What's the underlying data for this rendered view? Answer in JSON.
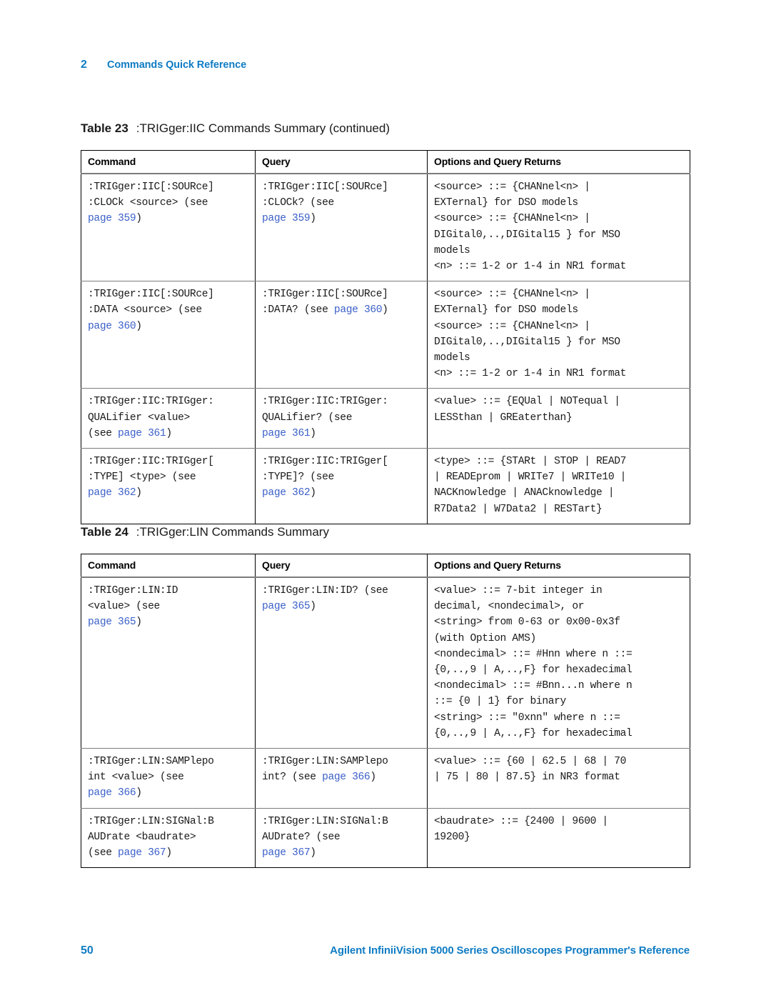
{
  "running_header": {
    "chapter_number": "2",
    "chapter_title": "Commands Quick Reference"
  },
  "colors": {
    "brand_blue": "#0f7cc4",
    "link_blue": "#3a5fc8",
    "rule_gray": "#7c7c7c",
    "border_black": "#000000"
  },
  "tables": [
    {
      "caption_label": "Table 23",
      "caption_text": ":TRIGger:IIC Commands Summary (continued)",
      "headers": [
        "Command",
        "Query",
        "Options and Query Returns"
      ],
      "rows": [
        {
          "command": ":TRIGger:IIC[:SOURce]\n:CLOCk <source> (see\npage 359)",
          "query": ":TRIGger:IIC[:SOURce]\n:CLOCk? (see\npage 359)",
          "options": "<source> ::= {CHANnel<n> |\nEXTernal} for DSO models\n<source> ::= {CHANnel<n> |\nDIGital0,..,DIGital15 } for MSO\nmodels\n<n> ::= 1-2 or 1-4 in NR1 format"
        },
        {
          "command": ":TRIGger:IIC[:SOURce]\n:DATA <source> (see\npage 360)",
          "query": ":TRIGger:IIC[:SOURce]\n:DATA? (see page 360)",
          "options": "<source> ::= {CHANnel<n> |\nEXTernal} for DSO models\n<source> ::= {CHANnel<n> |\nDIGital0,..,DIGital15 } for MSO\nmodels\n<n> ::= 1-2 or 1-4 in NR1 format"
        },
        {
          "command": ":TRIGger:IIC:TRIGger:\nQUALifier <value>\n(see page 361)",
          "query": ":TRIGger:IIC:TRIGger:\nQUALifier? (see\npage 361)",
          "options": "<value> ::= {EQUal | NOTequal |\nLESSthan | GREaterthan}"
        },
        {
          "command": ":TRIGger:IIC:TRIGger[\n:TYPE] <type> (see\npage 362)",
          "query": ":TRIGger:IIC:TRIGger[\n:TYPE]? (see\npage 362)",
          "options": "<type> ::= {STARt | STOP | READ7\n| READEprom | WRITe7 | WRITe10 |\nNACKnowledge | ANACknowledge |\nR7Data2 | W7Data2 | RESTart}"
        }
      ]
    },
    {
      "caption_label": "Table 24",
      "caption_text": ":TRIGger:LIN Commands Summary",
      "headers": [
        "Command",
        "Query",
        "Options and Query Returns"
      ],
      "rows": [
        {
          "command": ":TRIGger:LIN:ID\n<value> (see\npage 365)",
          "query": ":TRIGger:LIN:ID? (see\npage 365)",
          "options": "<value> ::= 7-bit integer in\ndecimal, <nondecimal>, or\n<string> from 0-63 or 0x00-0x3f\n(with Option AMS)\n<nondecimal> ::= #Hnn where n ::=\n{0,..,9 | A,..,F} for hexadecimal\n<nondecimal> ::= #Bnn...n where n\n::= {0 | 1} for binary\n<string> ::= \"0xnn\" where n ::=\n{0,..,9 | A,..,F} for hexadecimal"
        },
        {
          "command": ":TRIGger:LIN:SAMPlepo\nint <value> (see\npage 366)",
          "query": ":TRIGger:LIN:SAMPlepo\nint? (see page 366)",
          "options": "<value> ::= {60 | 62.5 | 68 | 70\n| 75 | 80 | 87.5} in NR3 format"
        },
        {
          "command": ":TRIGger:LIN:SIGNal:B\nAUDrate <baudrate>\n(see page 367)",
          "query": ":TRIGger:LIN:SIGNal:B\nAUDrate? (see\npage 367)",
          "options": "<baudrate> ::= {2400 | 9600 |\n19200}"
        }
      ]
    }
  ],
  "footer": {
    "page_number": "50",
    "document_title": "Agilent InfiniiVision 5000 Series Oscilloscopes Programmer's Reference"
  }
}
